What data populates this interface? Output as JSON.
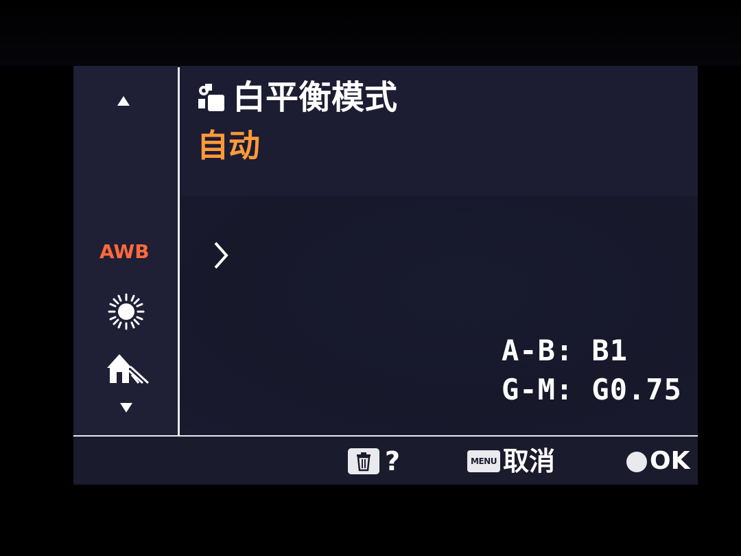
{
  "menu": {
    "title": "白平衡模式",
    "selected_value": "自动"
  },
  "wb_list": {
    "items": [
      {
        "label": "AWB",
        "icon": "awb-icon",
        "selected": true
      },
      {
        "label": "",
        "icon": "daylight-icon",
        "selected": false
      },
      {
        "label": "",
        "icon": "shade-icon",
        "selected": false
      }
    ]
  },
  "fine_tune": {
    "ab": "A-B: B1",
    "gm": "G-M: G0.75"
  },
  "bottom_bar": {
    "help_label": "?",
    "menu_button_label": "MENU",
    "cancel_label": "取消",
    "ok_label": "OK"
  },
  "colors": {
    "background": "#1c1c33",
    "selected_accent": "#ff6a3a",
    "value_accent": "#ff9a3a",
    "text": "#ffffff"
  }
}
